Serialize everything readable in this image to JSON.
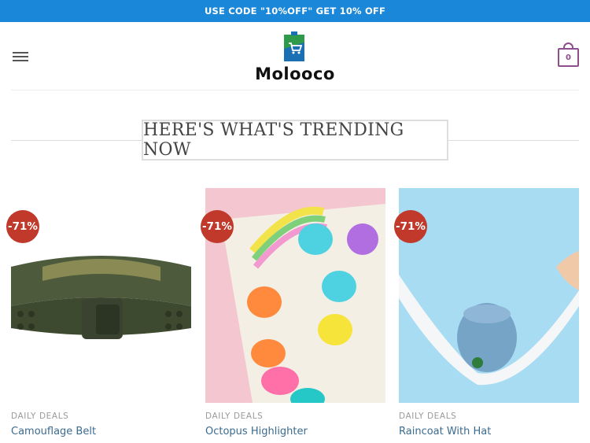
{
  "promo": {
    "text": "USE CODE \"10%OFF\" GET 10% OFF"
  },
  "header": {
    "logo_text": "Molooco",
    "cart_count": "0"
  },
  "section": {
    "title": "HERE'S WHAT'S TRENDING NOW"
  },
  "products": [
    {
      "badge": "-71%",
      "category": "DAILY DEALS",
      "name": "Camouflage Belt",
      "icon": "belt-image"
    },
    {
      "badge": "-71%",
      "category": "DAILY DEALS",
      "name": "Octopus Highlighter",
      "icon": "highlighter-image"
    },
    {
      "badge": "-71%",
      "category": "DAILY DEALS",
      "name": "Raincoat With Hat",
      "icon": "raincoat-image"
    }
  ],
  "colors": {
    "promo_bg": "#1a87d9",
    "badge_bg": "#c0392b",
    "cart_accent": "#8e4d8c",
    "link": "#3b6b8f"
  }
}
